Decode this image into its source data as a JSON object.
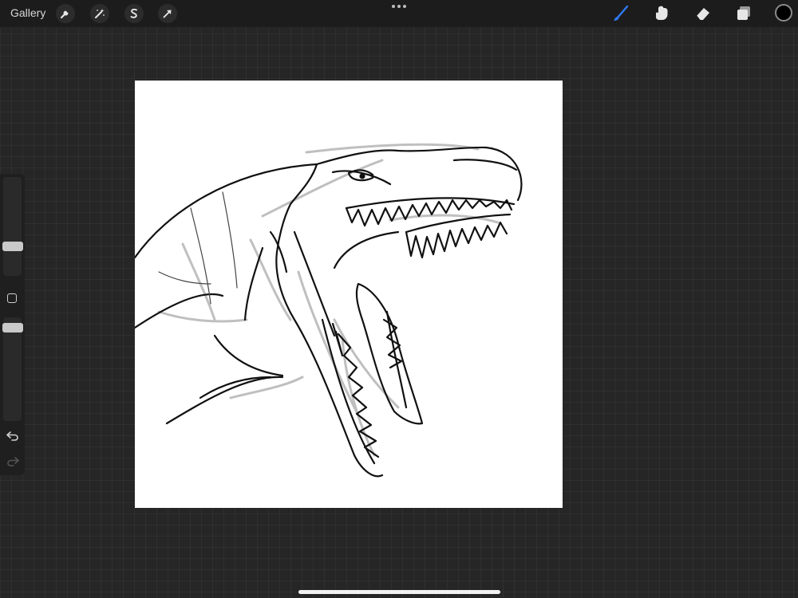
{
  "topbar": {
    "gallery_label": "Gallery",
    "left_tools": [
      {
        "name": "actions",
        "icon": "wrench-icon"
      },
      {
        "name": "adjustments",
        "icon": "magic-wand-icon"
      },
      {
        "name": "selection",
        "icon": "selection-s-icon"
      },
      {
        "name": "transform",
        "icon": "arrow-cursor-icon"
      }
    ],
    "more_icon": "ellipsis-icon",
    "right_tools": [
      {
        "name": "brush",
        "icon": "brush-icon",
        "active": true
      },
      {
        "name": "smudge",
        "icon": "smudge-finger-icon",
        "active": false
      },
      {
        "name": "eraser",
        "icon": "eraser-icon",
        "active": false
      },
      {
        "name": "layers",
        "icon": "layers-icon",
        "active": false
      }
    ],
    "current_color": "#000000",
    "accent_color": "#2f7bf5"
  },
  "sidebar": {
    "brush_size_level": 0.28,
    "opacity_level": 0.93,
    "icons": [
      "modify-square-icon",
      "undo-icon",
      "redo-icon"
    ]
  },
  "canvas": {
    "background": "#ffffff",
    "artwork": "dinosaur-head-sketch"
  }
}
